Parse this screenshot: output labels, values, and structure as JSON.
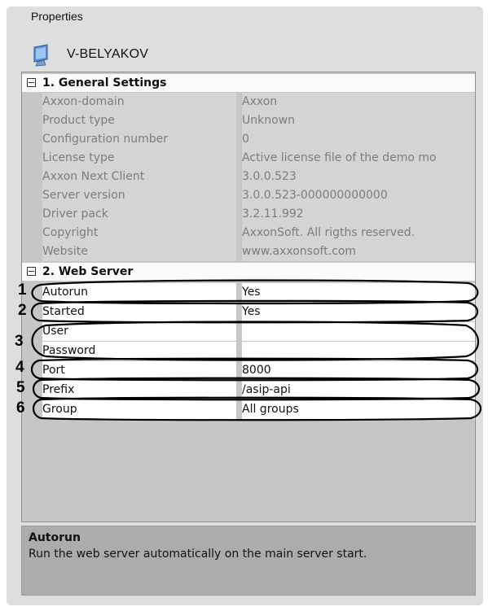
{
  "panel": {
    "title": "Properties"
  },
  "server": {
    "name": "V-BELYAKOV",
    "icon": "monitor-icon"
  },
  "categories": [
    {
      "label": "1. General Settings",
      "rows": [
        {
          "name": "Axxon-domain",
          "value": "Axxon"
        },
        {
          "name": "Product type",
          "value": "Unknown"
        },
        {
          "name": "Configuration number",
          "value": "0"
        },
        {
          "name": "License type",
          "value": "Active license file of the demo mo"
        },
        {
          "name": "Axxon Next Client",
          "value": "3.0.0.523"
        },
        {
          "name": "Server version",
          "value": "3.0.0.523-000000000000"
        },
        {
          "name": "Driver pack",
          "value": "3.2.11.992"
        },
        {
          "name": "Copyright",
          "value": "AxxonSoft. All rigths reserved."
        },
        {
          "name": "Website",
          "value": "www.axxonsoft.com"
        }
      ]
    },
    {
      "label": "2. Web Server",
      "rows": [
        {
          "name": "Autorun",
          "value": "Yes"
        },
        {
          "name": "Started",
          "value": "Yes"
        },
        {
          "name": "User",
          "value": ""
        },
        {
          "name": "Password",
          "value": ""
        },
        {
          "name": "Port",
          "value": "8000"
        },
        {
          "name": "Prefix",
          "value": "/asip-api"
        },
        {
          "name": "Group",
          "value": "All groups"
        }
      ]
    }
  ],
  "callouts": [
    "1",
    "2",
    "3",
    "4",
    "5",
    "6"
  ],
  "description": {
    "title": "Autorun",
    "text": "Run the web server automatically on the main server start."
  },
  "colors": {
    "panel_bg": "#dedede",
    "readonly_text": "#7c7c7c",
    "grid_bg": "#c6c6c6"
  }
}
